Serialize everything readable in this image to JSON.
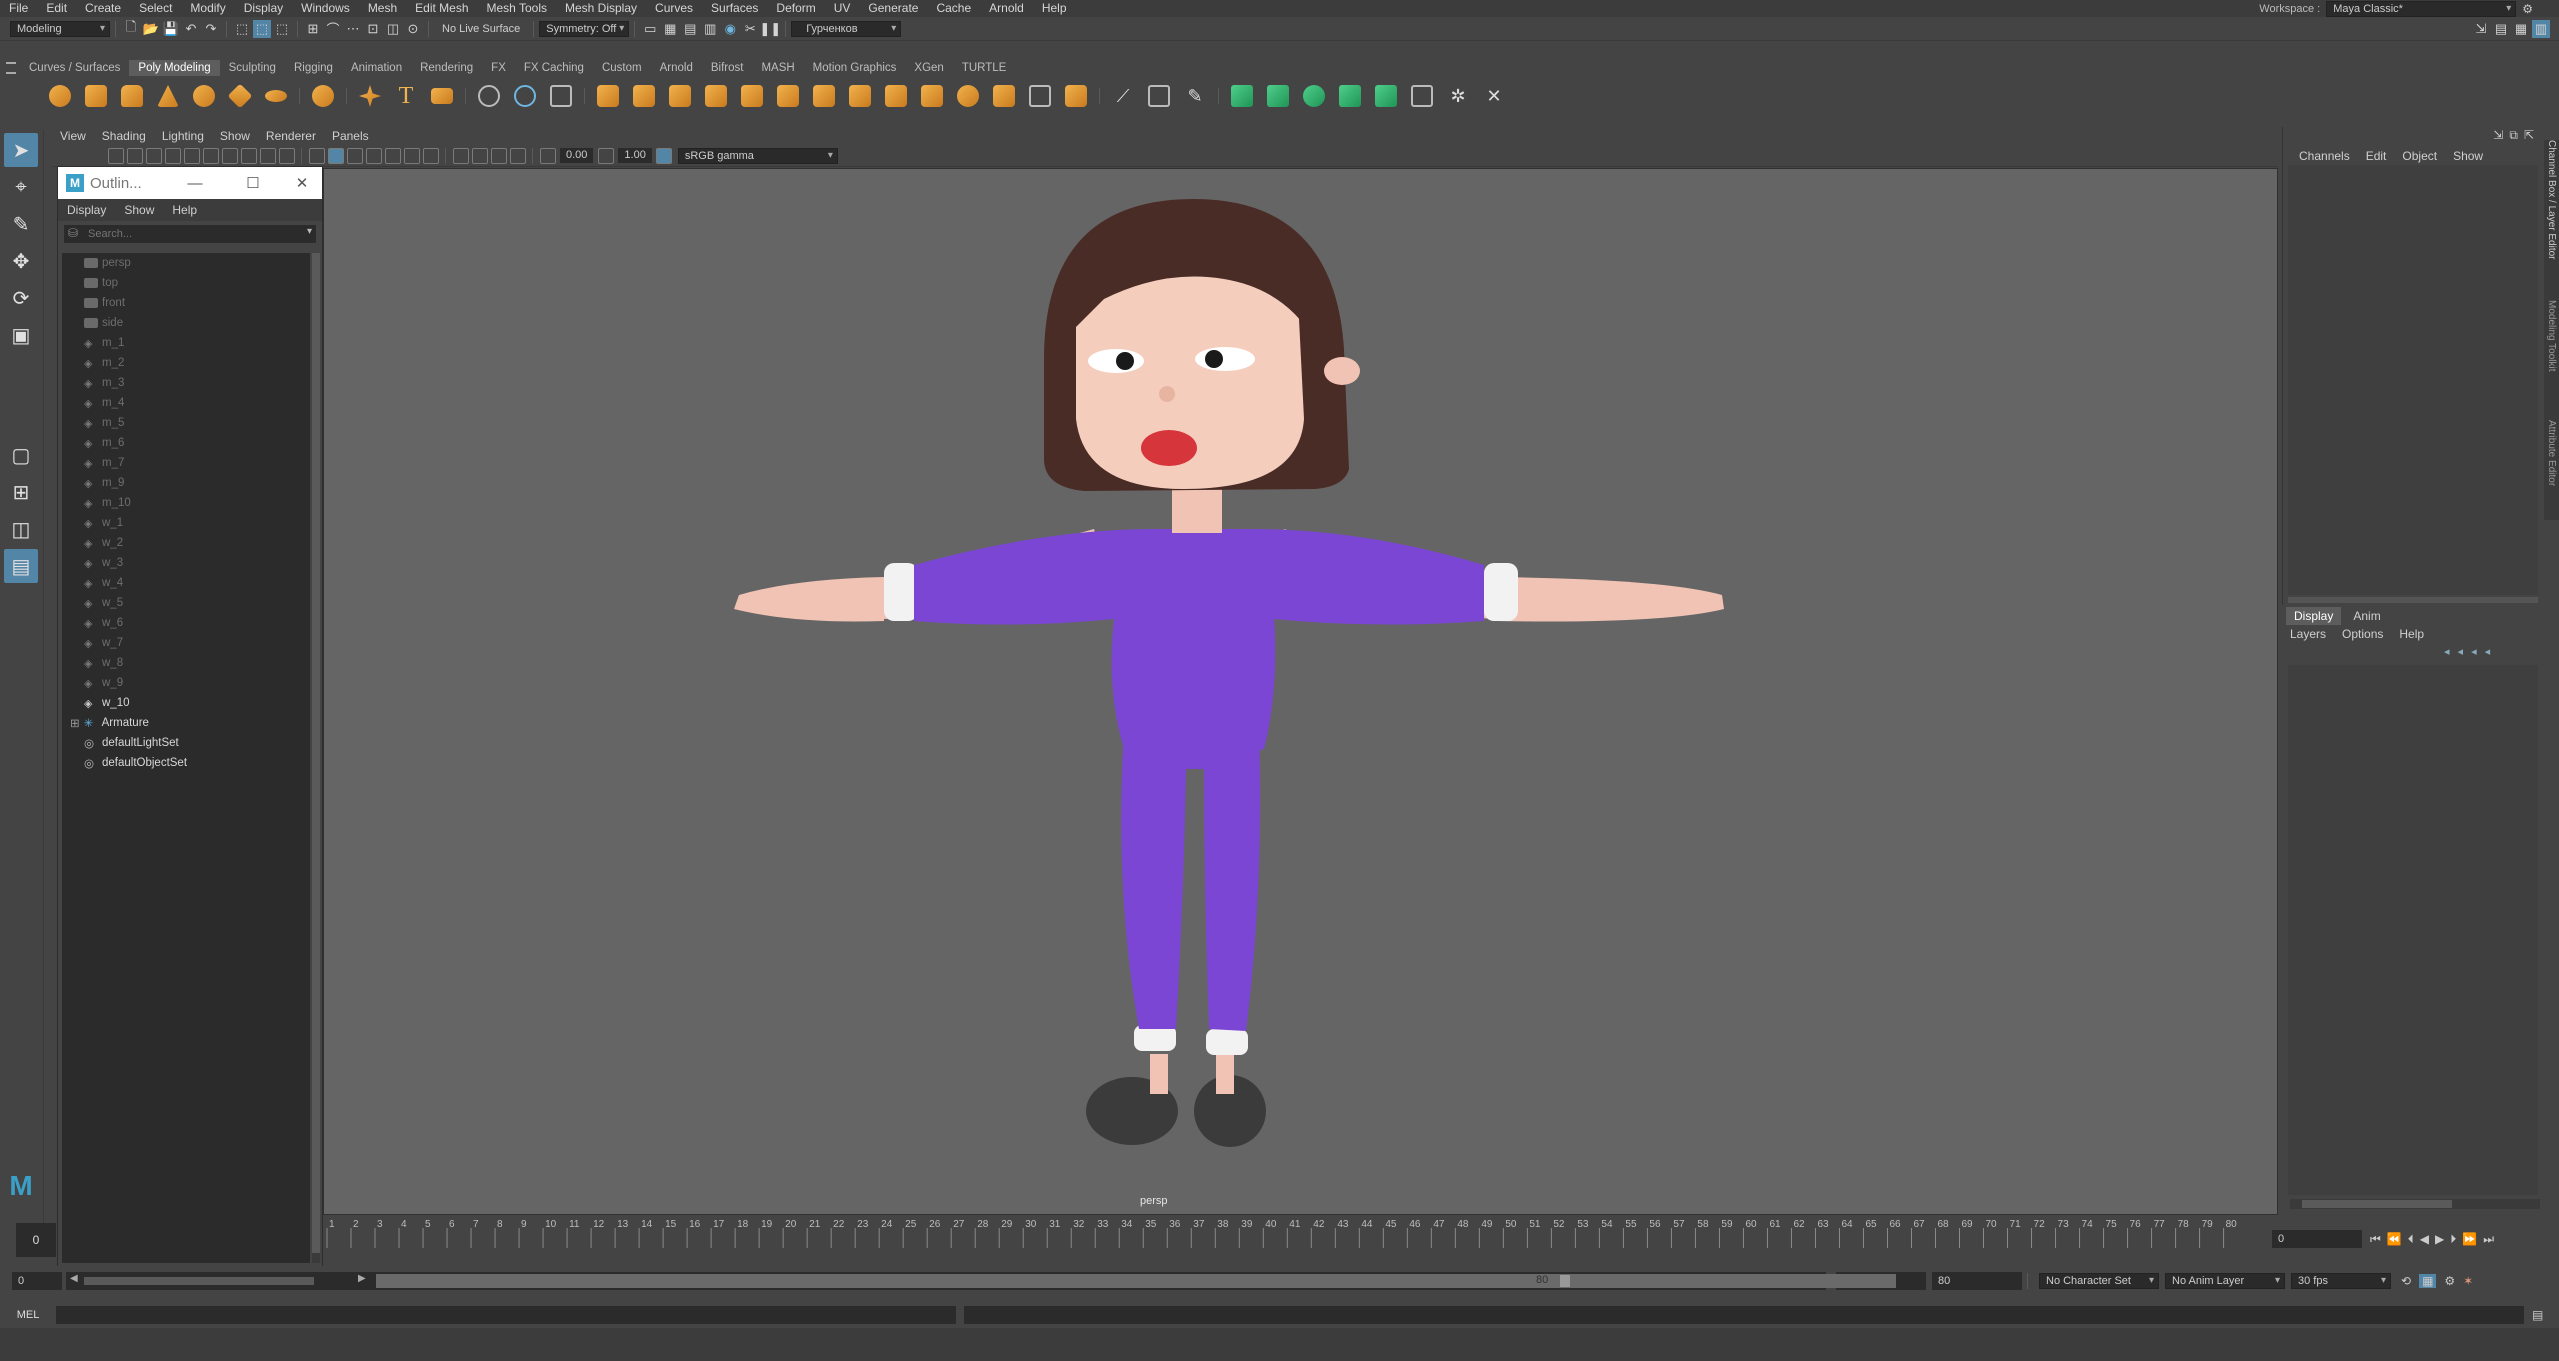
{
  "menubar": {
    "items": [
      "File",
      "Edit",
      "Create",
      "Select",
      "Modify",
      "Display",
      "Windows",
      "Mesh",
      "Edit Mesh",
      "Mesh Tools",
      "Mesh Display",
      "Curves",
      "Surfaces",
      "Deform",
      "UV",
      "Generate",
      "Cache",
      "Arnold",
      "Help"
    ],
    "workspace_label": "Workspace :",
    "workspace_value": "Maya Classic*"
  },
  "statusline": {
    "mode": "Modeling",
    "live_surface": "No Live Surface",
    "symmetry": "Symmetry: Off",
    "user": "Гурченков"
  },
  "shelf": {
    "tabs": [
      "Curves / Surfaces",
      "Poly Modeling",
      "Sculpting",
      "Rigging",
      "Animation",
      "Rendering",
      "FX",
      "FX Caching",
      "Custom",
      "Arnold",
      "Bifrost",
      "MASH",
      "Motion Graphics",
      "XGen",
      "TURTLE"
    ],
    "active_tab": "Poly Modeling"
  },
  "viewport": {
    "menu": [
      "View",
      "Shading",
      "Lighting",
      "Show",
      "Renderer",
      "Panels"
    ],
    "exposure": "0.00",
    "gamma": "1.00",
    "colorspace": "sRGB gamma",
    "camera_label": "persp"
  },
  "outliner": {
    "title": "Outlin...",
    "menu": [
      "Display",
      "Show",
      "Help"
    ],
    "search_placeholder": "Search...",
    "items": [
      {
        "label": "persp",
        "type": "camera",
        "dim": true
      },
      {
        "label": "top",
        "type": "camera",
        "dim": true
      },
      {
        "label": "front",
        "type": "camera",
        "dim": true
      },
      {
        "label": "side",
        "type": "camera",
        "dim": true
      },
      {
        "label": "m_1",
        "type": "mesh",
        "dim": true
      },
      {
        "label": "m_2",
        "type": "mesh",
        "dim": true
      },
      {
        "label": "m_3",
        "type": "mesh",
        "dim": true
      },
      {
        "label": "m_4",
        "type": "mesh",
        "dim": true
      },
      {
        "label": "m_5",
        "type": "mesh",
        "dim": true
      },
      {
        "label": "m_6",
        "type": "mesh",
        "dim": true
      },
      {
        "label": "m_7",
        "type": "mesh",
        "dim": true
      },
      {
        "label": "m_9",
        "type": "mesh",
        "dim": true
      },
      {
        "label": "m_10",
        "type": "mesh",
        "dim": true
      },
      {
        "label": "w_1",
        "type": "mesh",
        "dim": true
      },
      {
        "label": "w_2",
        "type": "mesh",
        "dim": true
      },
      {
        "label": "w_3",
        "type": "mesh",
        "dim": true
      },
      {
        "label": "w_4",
        "type": "mesh",
        "dim": true
      },
      {
        "label": "w_5",
        "type": "mesh",
        "dim": true
      },
      {
        "label": "w_6",
        "type": "mesh",
        "dim": true
      },
      {
        "label": "w_7",
        "type": "mesh",
        "dim": true
      },
      {
        "label": "w_8",
        "type": "mesh",
        "dim": true
      },
      {
        "label": "w_9",
        "type": "mesh",
        "dim": true
      },
      {
        "label": "w_10",
        "type": "mesh",
        "dim": false
      },
      {
        "label": "Armature",
        "type": "joint",
        "dim": false
      },
      {
        "label": "defaultLightSet",
        "type": "set",
        "dim": false
      },
      {
        "label": "defaultObjectSet",
        "type": "set",
        "dim": false
      }
    ]
  },
  "channelbox": {
    "menu": [
      "Channels",
      "Edit",
      "Object",
      "Show"
    ]
  },
  "layereditor": {
    "tabs": [
      "Display",
      "Anim"
    ],
    "menu": [
      "Layers",
      "Options",
      "Help"
    ]
  },
  "sidetabs": [
    "Channel Box / Layer Editor",
    "Modeling Toolkit",
    "Attribute Editor"
  ],
  "timeslider": {
    "ticks": [
      "1",
      "2",
      "3",
      "4",
      "5",
      "6",
      "7",
      "8",
      "9",
      "10",
      "11",
      "12",
      "13",
      "14",
      "15",
      "16",
      "17",
      "18",
      "19",
      "20",
      "21",
      "22",
      "23",
      "24",
      "25",
      "26",
      "27",
      "28",
      "29",
      "30",
      "31",
      "32",
      "33",
      "34",
      "35",
      "36",
      "37",
      "38",
      "39",
      "40",
      "41",
      "42",
      "43",
      "44",
      "45",
      "46",
      "47",
      "48",
      "49",
      "50",
      "51",
      "52",
      "53",
      "54",
      "55",
      "56",
      "57",
      "58",
      "59",
      "60",
      "61",
      "62",
      "63",
      "64",
      "65",
      "66",
      "67",
      "68",
      "69",
      "70",
      "71",
      "72",
      "73",
      "74",
      "75",
      "76",
      "77",
      "78",
      "79",
      "80"
    ],
    "current_frame": "0",
    "current_frame_field": "0"
  },
  "rangeslider": {
    "start": "0",
    "range_end": "80",
    "end1": "80",
    "end2": "80",
    "character_set": "No Character Set",
    "anim_layer": "No Anim Layer",
    "fps": "30 fps"
  },
  "cmdline": {
    "label": "MEL"
  }
}
